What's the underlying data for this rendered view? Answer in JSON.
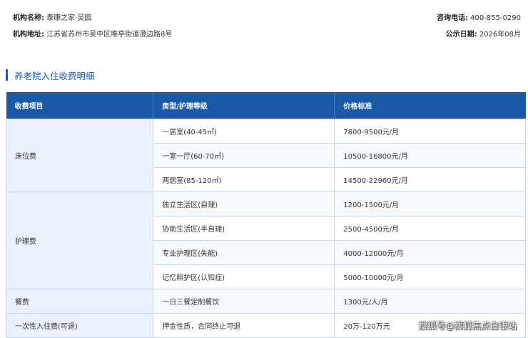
{
  "institution": {
    "name_label": "机构名称:",
    "name_value": "泰康之家·吴园",
    "address_label": "机构地址:",
    "address_value": "江苏省苏州市吴中区唯亭街道澄边路8号",
    "phone_label": "咨询电话:",
    "phone_value": "400-855-0290",
    "date_label": "公示日期:",
    "date_value": "2026年08月"
  },
  "section_title": "养老院入住收费明细",
  "table": {
    "headers": [
      "收费项目",
      "房型/护理等级",
      "价格标准"
    ],
    "groups": [
      {
        "category": "床位费",
        "rows": [
          {
            "level": "一居室(40-45㎡)",
            "price": "7800-9500元/月"
          },
          {
            "level": "一室一厅(60-70㎡)",
            "price": "10500-16800元/月"
          },
          {
            "level": "两居室(85-120㎡)",
            "price": "14500-22960元/月"
          }
        ]
      },
      {
        "category": "护理费",
        "rows": [
          {
            "level": "独立生活区(自理)",
            "price": "1200-1500元/月"
          },
          {
            "level": "协助生活区(半自理)",
            "price": "2500-4500元/月"
          },
          {
            "level": "专业护理区(失能)",
            "price": "4000-12000元/月"
          },
          {
            "level": "记忆照护区(认知症)",
            "price": "5000-10000元/月"
          }
        ]
      },
      {
        "category": "餐费",
        "rows": [
          {
            "level": "一日三餐定制餐饮",
            "price": "1300元/人/月"
          }
        ]
      },
      {
        "category": "一次性入住费(可退)",
        "rows": [
          {
            "level": "押金性质，合同终止可退",
            "price": "20万-120万元"
          }
        ]
      }
    ]
  },
  "watermark": "搜狐号@搜狐焦点白银站",
  "colors": {
    "header_bg": "#1a59a7",
    "accent": "#1e5aa8",
    "category_bg": "#eaf1fa",
    "border": "#c9d8ea"
  }
}
